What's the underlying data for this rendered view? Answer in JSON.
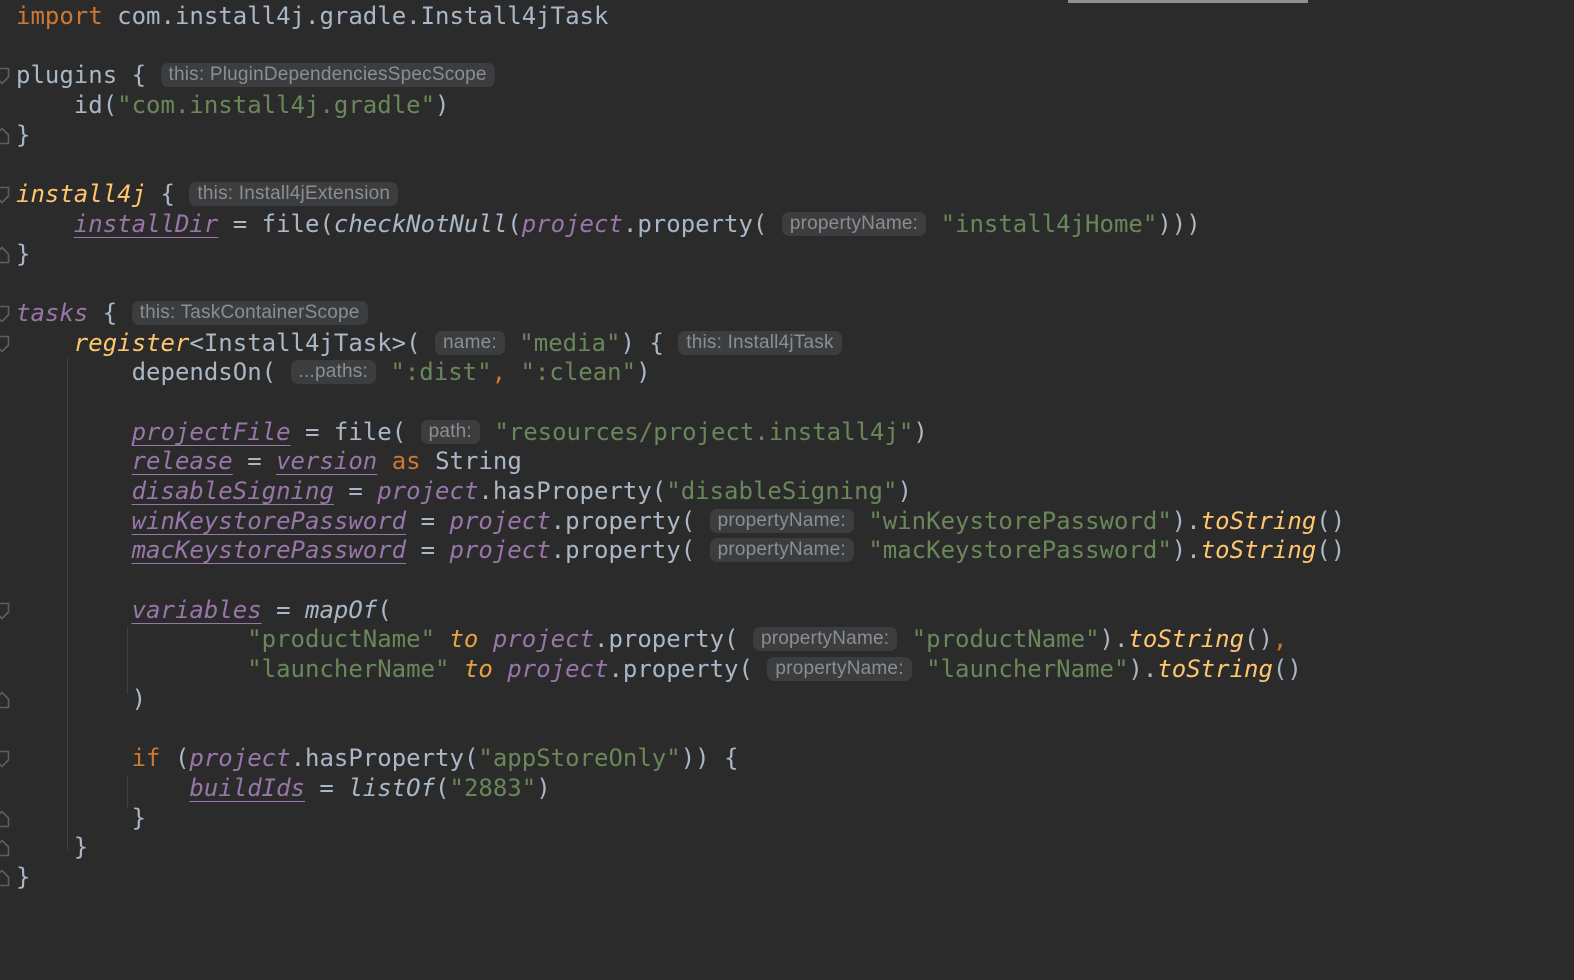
{
  "editor": {
    "language": "Gradle Kotlin DSL",
    "colors": {
      "background": "#2b2b2b",
      "default_text": "#a9b7c6",
      "keyword": "#cc7832",
      "string": "#6a8759",
      "mutable_property": "#9876aa",
      "function_call_yellow": "#ffc66d",
      "infix_to": "#e8a33d",
      "inlay_hint_text": "#8b8e92",
      "inlay_hint_background": "#3b3d3e",
      "indent_guide": "#3f4244",
      "fold_icon": "#5c5f61",
      "scrollbar": "#909090"
    }
  },
  "lines": [
    {
      "icon": null,
      "tokens": [
        [
          "k",
          "import"
        ],
        [
          "t",
          " com.install4j.gradle.Install4jTask"
        ]
      ]
    },
    {
      "icon": null,
      "tokens": []
    },
    {
      "icon": "start",
      "tokens": [
        [
          "t",
          "plugins { "
        ],
        [
          "h",
          "this: PluginDependenciesSpecScope"
        ]
      ]
    },
    {
      "icon": null,
      "tokens": [
        [
          "t",
          "    id("
        ],
        [
          "s",
          "\"com.install4j.gradle\""
        ],
        [
          "t",
          ")"
        ]
      ]
    },
    {
      "icon": "end",
      "tokens": [
        [
          "t",
          "}"
        ]
      ]
    },
    {
      "icon": null,
      "tokens": []
    },
    {
      "icon": "start",
      "tokens": [
        [
          "y",
          "install4j"
        ],
        [
          "t",
          " { "
        ],
        [
          "h",
          "this: Install4jExtension"
        ]
      ]
    },
    {
      "icon": null,
      "tokens": [
        [
          "t",
          "    "
        ],
        [
          "f",
          "installDir"
        ],
        [
          "t",
          " = file("
        ],
        [
          "i",
          "checkNotNull"
        ],
        [
          "t",
          "("
        ],
        [
          "r",
          "project"
        ],
        [
          "t",
          ".property( "
        ],
        [
          "h",
          "propertyName:"
        ],
        [
          "t",
          " "
        ],
        [
          "s",
          "\"install4jHome\""
        ],
        [
          "t",
          ")))"
        ]
      ]
    },
    {
      "icon": "end",
      "tokens": [
        [
          "t",
          "}"
        ]
      ]
    },
    {
      "icon": null,
      "tokens": []
    },
    {
      "icon": "start",
      "tokens": [
        [
          "r",
          "tasks"
        ],
        [
          "t",
          " { "
        ],
        [
          "h",
          "this: TaskContainerScope"
        ]
      ]
    },
    {
      "icon": "start",
      "tokens": [
        [
          "t",
          "    "
        ],
        [
          "y",
          "register"
        ],
        [
          "t",
          "<Install4jTask>( "
        ],
        [
          "h",
          "name:"
        ],
        [
          "t",
          " "
        ],
        [
          "s",
          "\"media\""
        ],
        [
          "t",
          ") { "
        ],
        [
          "h",
          "this: Install4jTask"
        ]
      ]
    },
    {
      "icon": null,
      "tokens": [
        [
          "t",
          "        dependsOn( "
        ],
        [
          "h",
          "...paths:"
        ],
        [
          "t",
          " "
        ],
        [
          "s",
          "\":dist\""
        ],
        [
          "o",
          ","
        ],
        [
          "t",
          " "
        ],
        [
          "s",
          "\":clean\""
        ],
        [
          "t",
          ")"
        ]
      ]
    },
    {
      "icon": null,
      "tokens": []
    },
    {
      "icon": null,
      "tokens": [
        [
          "t",
          "        "
        ],
        [
          "f",
          "projectFile"
        ],
        [
          "t",
          " = file( "
        ],
        [
          "h",
          "path:"
        ],
        [
          "t",
          " "
        ],
        [
          "s",
          "\"resources/project.install4j\""
        ],
        [
          "t",
          ")"
        ]
      ]
    },
    {
      "icon": null,
      "tokens": [
        [
          "t",
          "        "
        ],
        [
          "f",
          "release"
        ],
        [
          "t",
          " = "
        ],
        [
          "f",
          "version"
        ],
        [
          "t",
          " "
        ],
        [
          "k",
          "as"
        ],
        [
          "t",
          " String"
        ]
      ]
    },
    {
      "icon": null,
      "tokens": [
        [
          "t",
          "        "
        ],
        [
          "f",
          "disableSigning"
        ],
        [
          "t",
          " = "
        ],
        [
          "r",
          "project"
        ],
        [
          "t",
          ".hasProperty("
        ],
        [
          "s",
          "\"disableSigning\""
        ],
        [
          "t",
          ")"
        ]
      ]
    },
    {
      "icon": null,
      "tokens": [
        [
          "t",
          "        "
        ],
        [
          "f",
          "winKeystorePassword"
        ],
        [
          "t",
          " = "
        ],
        [
          "r",
          "project"
        ],
        [
          "t",
          ".property( "
        ],
        [
          "h",
          "propertyName:"
        ],
        [
          "t",
          " "
        ],
        [
          "s",
          "\"winKeystorePassword\""
        ],
        [
          "t",
          ")."
        ],
        [
          "y",
          "toString"
        ],
        [
          "t",
          "()"
        ]
      ]
    },
    {
      "icon": null,
      "tokens": [
        [
          "t",
          "        "
        ],
        [
          "f",
          "macKeystorePassword"
        ],
        [
          "t",
          " = "
        ],
        [
          "r",
          "project"
        ],
        [
          "t",
          ".property( "
        ],
        [
          "h",
          "propertyName:"
        ],
        [
          "t",
          " "
        ],
        [
          "s",
          "\"macKeystorePassword\""
        ],
        [
          "t",
          ")."
        ],
        [
          "y",
          "toString"
        ],
        [
          "t",
          "()"
        ]
      ]
    },
    {
      "icon": null,
      "tokens": []
    },
    {
      "icon": "start",
      "tokens": [
        [
          "t",
          "        "
        ],
        [
          "f",
          "variables"
        ],
        [
          "t",
          " = "
        ],
        [
          "i",
          "mapOf"
        ],
        [
          "t",
          "("
        ]
      ]
    },
    {
      "icon": null,
      "tokens": [
        [
          "t",
          "                "
        ],
        [
          "s",
          "\"productName\""
        ],
        [
          "t",
          " "
        ],
        [
          "x",
          "to"
        ],
        [
          "t",
          " "
        ],
        [
          "r",
          "project"
        ],
        [
          "t",
          ".property( "
        ],
        [
          "h",
          "propertyName:"
        ],
        [
          "t",
          " "
        ],
        [
          "s",
          "\"productName\""
        ],
        [
          "t",
          ")."
        ],
        [
          "y",
          "toString"
        ],
        [
          "t",
          "()"
        ],
        [
          "o",
          ","
        ]
      ]
    },
    {
      "icon": null,
      "tokens": [
        [
          "t",
          "                "
        ],
        [
          "s",
          "\"launcherName\""
        ],
        [
          "t",
          " "
        ],
        [
          "x",
          "to"
        ],
        [
          "t",
          " "
        ],
        [
          "r",
          "project"
        ],
        [
          "t",
          ".property( "
        ],
        [
          "h",
          "propertyName:"
        ],
        [
          "t",
          " "
        ],
        [
          "s",
          "\"launcherName\""
        ],
        [
          "t",
          ")."
        ],
        [
          "y",
          "toString"
        ],
        [
          "t",
          "()"
        ]
      ]
    },
    {
      "icon": "end",
      "tokens": [
        [
          "t",
          "        )"
        ]
      ]
    },
    {
      "icon": null,
      "tokens": []
    },
    {
      "icon": "start",
      "tokens": [
        [
          "t",
          "        "
        ],
        [
          "k",
          "if"
        ],
        [
          "t",
          " ("
        ],
        [
          "r",
          "project"
        ],
        [
          "t",
          ".hasProperty("
        ],
        [
          "s",
          "\"appStoreOnly\""
        ],
        [
          "t",
          ")) {"
        ]
      ]
    },
    {
      "icon": null,
      "tokens": [
        [
          "t",
          "            "
        ],
        [
          "f",
          "buildIds"
        ],
        [
          "t",
          " = "
        ],
        [
          "i",
          "listOf"
        ],
        [
          "t",
          "("
        ],
        [
          "s",
          "\"2883\""
        ],
        [
          "t",
          ")"
        ]
      ]
    },
    {
      "icon": "end",
      "tokens": [
        [
          "t",
          "        }"
        ]
      ]
    },
    {
      "icon": "end",
      "tokens": [
        [
          "t",
          "    }"
        ]
      ]
    },
    {
      "icon": "end",
      "tokens": [
        [
          "t",
          "}"
        ]
      ]
    }
  ]
}
